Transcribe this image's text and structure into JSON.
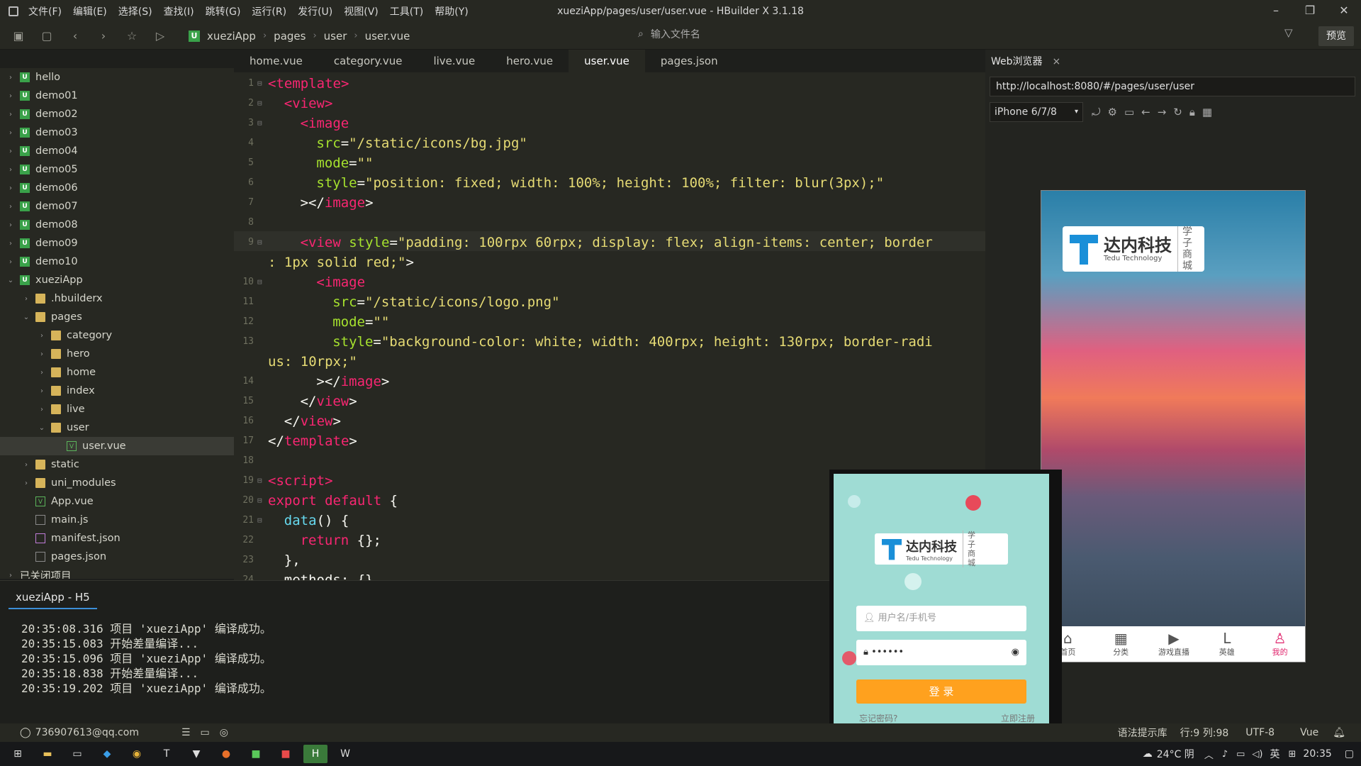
{
  "window": {
    "title": "xueziApp/pages/user/user.vue - HBuilder X 3.1.18",
    "menus": [
      "文件(F)",
      "编辑(E)",
      "选择(S)",
      "查找(I)",
      "跳转(G)",
      "运行(R)",
      "发行(U)",
      "视图(V)",
      "工具(T)",
      "帮助(Y)"
    ]
  },
  "toolbar": {
    "breadcrumb": [
      "xueziApp",
      "pages",
      "user",
      "user.vue"
    ],
    "file_search_placeholder": "输入文件名",
    "preview_label": "预览"
  },
  "tree": [
    {
      "label": "hello",
      "kind": "proj",
      "depth": 0,
      "arrow": "›"
    },
    {
      "label": "demo01",
      "kind": "proj",
      "depth": 0,
      "arrow": "›"
    },
    {
      "label": "demo02",
      "kind": "proj",
      "depth": 0,
      "arrow": "›"
    },
    {
      "label": "demo03",
      "kind": "proj",
      "depth": 0,
      "arrow": "›"
    },
    {
      "label": "demo04",
      "kind": "proj",
      "depth": 0,
      "arrow": "›"
    },
    {
      "label": "demo05",
      "kind": "proj",
      "depth": 0,
      "arrow": "›"
    },
    {
      "label": "demo06",
      "kind": "proj",
      "depth": 0,
      "arrow": "›"
    },
    {
      "label": "demo07",
      "kind": "proj",
      "depth": 0,
      "arrow": "›"
    },
    {
      "label": "demo08",
      "kind": "proj",
      "depth": 0,
      "arrow": "›"
    },
    {
      "label": "demo09",
      "kind": "proj",
      "depth": 0,
      "arrow": "›"
    },
    {
      "label": "demo10",
      "kind": "proj",
      "depth": 0,
      "arrow": "›"
    },
    {
      "label": "xueziApp",
      "kind": "proj",
      "depth": 0,
      "arrow": "⌄"
    },
    {
      "label": ".hbuilderx",
      "kind": "folder",
      "depth": 1,
      "arrow": "›"
    },
    {
      "label": "pages",
      "kind": "folder",
      "depth": 1,
      "arrow": "⌄"
    },
    {
      "label": "category",
      "kind": "folder",
      "depth": 2,
      "arrow": "›"
    },
    {
      "label": "hero",
      "kind": "folder",
      "depth": 2,
      "arrow": "›"
    },
    {
      "label": "home",
      "kind": "folder",
      "depth": 2,
      "arrow": "›"
    },
    {
      "label": "index",
      "kind": "folder",
      "depth": 2,
      "arrow": "›"
    },
    {
      "label": "live",
      "kind": "folder",
      "depth": 2,
      "arrow": "›"
    },
    {
      "label": "user",
      "kind": "folder",
      "depth": 2,
      "arrow": "⌄"
    },
    {
      "label": "user.vue",
      "kind": "vue",
      "depth": 3,
      "arrow": "",
      "selected": true
    },
    {
      "label": "static",
      "kind": "folder",
      "depth": 1,
      "arrow": "›"
    },
    {
      "label": "uni_modules",
      "kind": "folder",
      "depth": 1,
      "arrow": "›"
    },
    {
      "label": "App.vue",
      "kind": "vue",
      "depth": 1,
      "arrow": ""
    },
    {
      "label": "main.js",
      "kind": "file",
      "depth": 1,
      "arrow": ""
    },
    {
      "label": "manifest.json",
      "kind": "json",
      "depth": 1,
      "arrow": ""
    },
    {
      "label": "pages.json",
      "kind": "file",
      "depth": 1,
      "arrow": ""
    },
    {
      "label": "已关闭项目",
      "kind": "none",
      "depth": 0,
      "arrow": "›"
    }
  ],
  "tabs": [
    "home.vue",
    "category.vue",
    "live.vue",
    "hero.vue",
    "user.vue",
    "pages.json"
  ],
  "active_tab": "user.vue",
  "code": [
    {
      "n": "1",
      "fold": "⊟",
      "indent": 0,
      "parts": [
        [
          "tag",
          "<template>"
        ]
      ]
    },
    {
      "n": "2",
      "fold": "⊟",
      "indent": 1,
      "parts": [
        [
          "tag",
          "<view>"
        ]
      ]
    },
    {
      "n": "3",
      "fold": "⊟",
      "indent": 2,
      "parts": [
        [
          "tag",
          "<image"
        ]
      ]
    },
    {
      "n": "4",
      "fold": "",
      "indent": 3,
      "parts": [
        [
          "attr",
          "src"
        ],
        [
          "plain",
          "="
        ],
        [
          "str",
          "\"/static/icons/bg.jpg\""
        ]
      ]
    },
    {
      "n": "5",
      "fold": "",
      "indent": 3,
      "parts": [
        [
          "attr",
          "mode"
        ],
        [
          "plain",
          "="
        ],
        [
          "str",
          "\"\""
        ]
      ]
    },
    {
      "n": "6",
      "fold": "",
      "indent": 3,
      "parts": [
        [
          "attr",
          "style"
        ],
        [
          "plain",
          "="
        ],
        [
          "str",
          "\"position: fixed; width: 100%; height: 100%; filter: blur(3px);\""
        ]
      ]
    },
    {
      "n": "7",
      "fold": "",
      "indent": 2,
      "parts": [
        [
          "plain",
          "></"
        ],
        [
          "tag",
          "image"
        ],
        [
          "plain",
          ">"
        ]
      ]
    },
    {
      "n": "8",
      "fold": "",
      "indent": 0,
      "parts": []
    },
    {
      "n": "9",
      "fold": "⊟",
      "indent": 2,
      "parts": [
        [
          "tag",
          "<view "
        ],
        [
          "attr",
          "style"
        ],
        [
          "plain",
          "="
        ],
        [
          "str",
          "\"padding: 100rpx 60rpx; display: flex; align-items: center; border"
        ]
      ]
    },
    {
      "n": "",
      "fold": "",
      "indent": 0,
      "parts": [
        [
          "str",
          ": 1px solid red;\""
        ],
        [
          "plain",
          ">"
        ]
      ]
    },
    {
      "n": "10",
      "fold": "⊟",
      "indent": 3,
      "parts": [
        [
          "tag",
          "<image"
        ]
      ]
    },
    {
      "n": "11",
      "fold": "",
      "indent": 4,
      "parts": [
        [
          "attr",
          "src"
        ],
        [
          "plain",
          "="
        ],
        [
          "str",
          "\"/static/icons/logo.png\""
        ]
      ]
    },
    {
      "n": "12",
      "fold": "",
      "indent": 4,
      "parts": [
        [
          "attr",
          "mode"
        ],
        [
          "plain",
          "="
        ],
        [
          "str",
          "\"\""
        ]
      ]
    },
    {
      "n": "13",
      "fold": "",
      "indent": 4,
      "parts": [
        [
          "attr",
          "style"
        ],
        [
          "plain",
          "="
        ],
        [
          "str",
          "\"background-color: white; width: 400rpx; height: 130rpx; border-radi"
        ]
      ]
    },
    {
      "n": "",
      "fold": "",
      "indent": 0,
      "parts": [
        [
          "str",
          "us: 10rpx;\""
        ]
      ]
    },
    {
      "n": "14",
      "fold": "",
      "indent": 3,
      "parts": [
        [
          "plain",
          "></"
        ],
        [
          "tag",
          "image"
        ],
        [
          "plain",
          ">"
        ]
      ]
    },
    {
      "n": "15",
      "fold": "",
      "indent": 2,
      "parts": [
        [
          "plain",
          "</"
        ],
        [
          "tag",
          "view"
        ],
        [
          "plain",
          ">"
        ]
      ]
    },
    {
      "n": "16",
      "fold": "",
      "indent": 1,
      "parts": [
        [
          "plain",
          "</"
        ],
        [
          "tag",
          "view"
        ],
        [
          "plain",
          ">"
        ]
      ]
    },
    {
      "n": "17",
      "fold": "",
      "indent": 0,
      "parts": [
        [
          "plain",
          "</"
        ],
        [
          "tag",
          "template"
        ],
        [
          "plain",
          ">"
        ]
      ]
    },
    {
      "n": "18",
      "fold": "",
      "indent": 0,
      "parts": []
    },
    {
      "n": "19",
      "fold": "⊟",
      "indent": 0,
      "parts": [
        [
          "tag",
          "<script>"
        ]
      ]
    },
    {
      "n": "20",
      "fold": "⊟",
      "indent": 0,
      "parts": [
        [
          "kw",
          "export default "
        ],
        [
          "plain",
          "{"
        ]
      ]
    },
    {
      "n": "21",
      "fold": "⊟",
      "indent": 1,
      "parts": [
        [
          "fn",
          "data"
        ],
        [
          "plain",
          "() {"
        ]
      ]
    },
    {
      "n": "22",
      "fold": "",
      "indent": 2,
      "parts": [
        [
          "kw",
          "return "
        ],
        [
          "plain",
          "{};"
        ]
      ]
    },
    {
      "n": "23",
      "fold": "",
      "indent": 1,
      "parts": [
        [
          "plain",
          "},"
        ]
      ]
    },
    {
      "n": "24",
      "fold": "",
      "indent": 1,
      "parts": [
        [
          "plain",
          "methods: {}"
        ]
      ]
    }
  ],
  "console": {
    "tab_label": "xueziApp - H5",
    "lines": [
      "20:35:08.316 项目 'xueziApp' 编译成功。",
      "20:35:15.083 开始差量编译...",
      "20:35:15.096 项目 'xueziApp' 编译成功。",
      "20:35:18.838 开始差量编译...",
      "20:35:19.202 项目 'xueziApp' 编译成功。"
    ]
  },
  "browser": {
    "tab_label": "Web浏览器",
    "url": "http://localhost:8080/#/pages/user/user",
    "device": "iPhone 6/7/8",
    "logo_main": "达内科技",
    "logo_sub": "Tedu Technology",
    "logo_side": "学子商城",
    "tabbar": [
      {
        "icon": "⌂",
        "label": "首页"
      },
      {
        "icon": "▦",
        "label": "分类"
      },
      {
        "icon": "▶",
        "label": "游戏直播"
      },
      {
        "icon": "L",
        "label": "英雄"
      },
      {
        "icon": "♙",
        "label": "我的"
      }
    ]
  },
  "overlay": {
    "logo_main": "达内科技",
    "logo_sub": "Tedu Technology",
    "logo_side": "学子商城",
    "username_placeholder": "用户名/手机号",
    "password_value": "••••••",
    "login_label": "登 录",
    "forgot_label": "忘记密码?",
    "register_label": "立即注册"
  },
  "status": {
    "account": "736907613@qq.com",
    "hint": "语法提示库",
    "position": "行:9  列:98",
    "encoding": "UTF-8",
    "language": "Vue"
  },
  "taskbar": {
    "weather": "24°C 阴",
    "ime": "英",
    "time": "20:35"
  }
}
